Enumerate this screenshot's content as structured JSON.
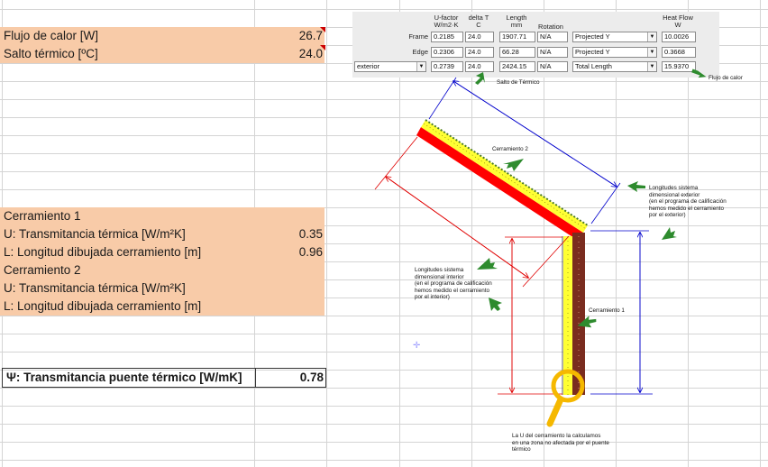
{
  "rows": {
    "flujo": {
      "label": "Flujo de calor [W]",
      "value": "26.7"
    },
    "salto": {
      "label": "Salto térmico [ºC]",
      "value": "24.0"
    },
    "cer1": {
      "label": "Cerramiento 1"
    },
    "u1": {
      "label": "U: Transmitancia térmica [W/m²K]",
      "value": "0.35"
    },
    "l1": {
      "label": "L: Longitud dibujada cerramiento [m]",
      "value": "0.96"
    },
    "cer2": {
      "label": "Cerramiento 2"
    },
    "u2": {
      "label": "U: Transmitancia térmica [W/m²K]",
      "value": ""
    },
    "l2": {
      "label": "L: Longitud dibujada cerramiento [m]",
      "value": ""
    },
    "psi": {
      "label": "Ψ: Transmitancia puente térmico [W/mK]",
      "value": "0.78"
    }
  },
  "thermal_table": {
    "headers": {
      "ufactor": "U-factor\nW/m2·K",
      "deltat": "delta T\nC",
      "length": "Length\nmm",
      "rotation": "Rotation",
      "heatflow": "Heat Flow\nW"
    },
    "rows": [
      {
        "label": "Frame",
        "u": "0.2185",
        "dt": "24.0",
        "len": "1907.71",
        "rot": "N/A",
        "proj": "Projected Y",
        "flow": "10.0026"
      },
      {
        "label": "Edge",
        "u": "0.2306",
        "dt": "24.0",
        "len": "66.28",
        "rot": "N/A",
        "proj": "Projected Y",
        "flow": "0.3668"
      },
      {
        "label": "exterior",
        "u": "0.2739",
        "dt": "24.0",
        "len": "2424.15",
        "rot": "N/A",
        "proj": "Total Length",
        "flow": "15.9370"
      }
    ]
  },
  "annotations": {
    "flujo": "Flujo de calor",
    "salto": "Salto de Térmico",
    "cerr2": "Cerramiento 2",
    "cerr1": "Cerramiento 1",
    "ext": "Longitudes sistema\ndimensional exterior\n(en el programa de calificación\nhemos medido el cerramiento\npor el exterior)",
    "int": "Longitudes sistema\ndimensional interior\n(en el programa de calificación\nhemos medido el cerramiento\npor el interior)",
    "u": "La U del cerramiento la calculamos\nen una zona no afectada por el puente\ntérmico"
  },
  "colors": {
    "orange": "#f8cba8",
    "red": "#ff0000",
    "yellow": "#ffff00",
    "brown": "#7a2c1f",
    "arrow": "#2e8b2e",
    "blue": "#0000cc",
    "dimred": "#e00000",
    "magnifier": "#f5b800"
  }
}
